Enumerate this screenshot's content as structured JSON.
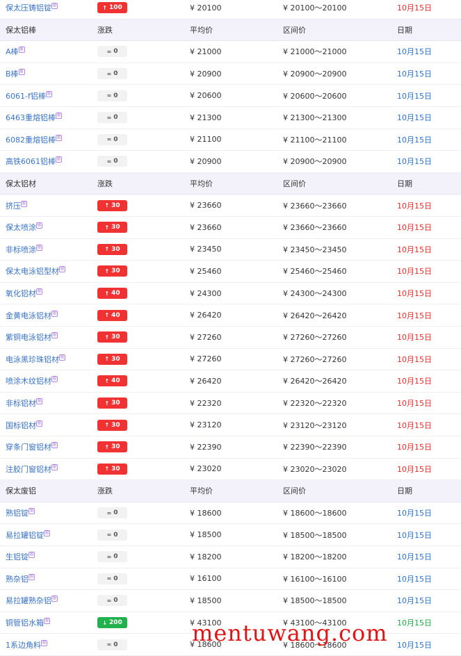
{
  "top_row": {
    "name": "保太压铸铝锭",
    "change": "100",
    "dir": "up",
    "avg": "¥  20100",
    "range": "¥  20100～20100",
    "date": "10月15日",
    "date_color": "red"
  },
  "sections": [
    {
      "header": {
        "name": "保太铝棒",
        "change": "涨跌",
        "avg": "平均价",
        "range": "区间价",
        "date": "日期"
      },
      "rows": [
        {
          "name": "A棒",
          "change": "0",
          "dir": "flat",
          "avg": "¥  21000",
          "range": "¥  21000～21000",
          "date": "10月15日",
          "date_color": "blue"
        },
        {
          "name": "B棒",
          "change": "0",
          "dir": "flat",
          "avg": "¥  20900",
          "range": "¥  20900～20900",
          "date": "10月15日",
          "date_color": "blue"
        },
        {
          "name": "6061-f铝棒",
          "change": "0",
          "dir": "flat",
          "avg": "¥  20600",
          "range": "¥  20600～20600",
          "date": "10月15日",
          "date_color": "blue"
        },
        {
          "name": "6463重熔铝棒",
          "change": "0",
          "dir": "flat",
          "avg": "¥  21300",
          "range": "¥  21300～21300",
          "date": "10月15日",
          "date_color": "blue"
        },
        {
          "name": "6082重熔铝棒",
          "change": "0",
          "dir": "flat",
          "avg": "¥  21100",
          "range": "¥  21100～21100",
          "date": "10月15日",
          "date_color": "blue"
        },
        {
          "name": "高铁6061铝棒",
          "change": "0",
          "dir": "flat",
          "avg": "¥  20900",
          "range": "¥  20900～20900",
          "date": "10月15日",
          "date_color": "blue"
        }
      ]
    },
    {
      "header": {
        "name": "保太铝材",
        "change": "涨跌",
        "avg": "平均价",
        "range": "区间价",
        "date": "日期"
      },
      "rows": [
        {
          "name": "挤压",
          "change": "30",
          "dir": "up",
          "avg": "¥  23660",
          "range": "¥  23660～23660",
          "date": "10月15日",
          "date_color": "red"
        },
        {
          "name": "保太喷涂",
          "change": "30",
          "dir": "up",
          "avg": "¥  23660",
          "range": "¥  23660～23660",
          "date": "10月15日",
          "date_color": "red"
        },
        {
          "name": "非标喷涂",
          "change": "30",
          "dir": "up",
          "avg": "¥  23450",
          "range": "¥  23450～23450",
          "date": "10月15日",
          "date_color": "red"
        },
        {
          "name": "保太电泳铝型材",
          "change": "30",
          "dir": "up",
          "avg": "¥  25460",
          "range": "¥  25460～25460",
          "date": "10月15日",
          "date_color": "red"
        },
        {
          "name": "氧化铝材",
          "change": "40",
          "dir": "up",
          "avg": "¥  24300",
          "range": "¥  24300～24300",
          "date": "10月15日",
          "date_color": "red"
        },
        {
          "name": "金黄电泳铝材",
          "change": "40",
          "dir": "up",
          "avg": "¥  26420",
          "range": "¥  26420～26420",
          "date": "10月15日",
          "date_color": "red"
        },
        {
          "name": "紫铜电泳铝材",
          "change": "30",
          "dir": "up",
          "avg": "¥  27260",
          "range": "¥  27260～27260",
          "date": "10月15日",
          "date_color": "red"
        },
        {
          "name": "电泳黑珍珠铝材",
          "change": "30",
          "dir": "up",
          "avg": "¥  27260",
          "range": "¥  27260～27260",
          "date": "10月15日",
          "date_color": "red"
        },
        {
          "name": "喷涂木纹铝材",
          "change": "40",
          "dir": "up",
          "avg": "¥  26420",
          "range": "¥  26420～26420",
          "date": "10月15日",
          "date_color": "red"
        },
        {
          "name": "非标铝材",
          "change": "30",
          "dir": "up",
          "avg": "¥  22320",
          "range": "¥  22320～22320",
          "date": "10月15日",
          "date_color": "red"
        },
        {
          "name": "国标铝材",
          "change": "30",
          "dir": "up",
          "avg": "¥  23120",
          "range": "¥  23120～23120",
          "date": "10月15日",
          "date_color": "red"
        },
        {
          "name": "穿条门窗铝材",
          "change": "30",
          "dir": "up",
          "avg": "¥  22390",
          "range": "¥  22390～22390",
          "date": "10月15日",
          "date_color": "red"
        },
        {
          "name": "注胶门窗铝材",
          "change": "30",
          "dir": "up",
          "avg": "¥  23020",
          "range": "¥  23020～23020",
          "date": "10月15日",
          "date_color": "red"
        }
      ]
    },
    {
      "header": {
        "name": "保太废铝",
        "change": "涨跌",
        "avg": "平均价",
        "range": "区间价",
        "date": "日期"
      },
      "rows": [
        {
          "name": "熟铝锭",
          "change": "0",
          "dir": "flat",
          "avg": "¥  18600",
          "range": "¥  18600～18600",
          "date": "10月15日",
          "date_color": "blue"
        },
        {
          "name": "易拉罐铝锭",
          "change": "0",
          "dir": "flat",
          "avg": "¥  18500",
          "range": "¥  18500～18500",
          "date": "10月15日",
          "date_color": "blue"
        },
        {
          "name": "生铝锭",
          "change": "0",
          "dir": "flat",
          "avg": "¥  18200",
          "range": "¥  18200～18200",
          "date": "10月15日",
          "date_color": "blue"
        },
        {
          "name": "熟杂铝",
          "change": "0",
          "dir": "flat",
          "avg": "¥  16100",
          "range": "¥  16100～16100",
          "date": "10月15日",
          "date_color": "blue"
        },
        {
          "name": "易拉罐熟杂铝",
          "change": "0",
          "dir": "flat",
          "avg": "¥  18500",
          "range": "¥  18500～18500",
          "date": "10月15日",
          "date_color": "blue"
        },
        {
          "name": "铜管铝水箱",
          "change": "200",
          "dir": "down",
          "avg": "¥  43100",
          "range": "¥  43100～43100",
          "date": "10月15日",
          "date_color": "green"
        },
        {
          "name": "1系边角料",
          "change": "0",
          "dir": "flat",
          "avg": "¥  18600",
          "range": "¥  18600～18600",
          "date": "10月15日",
          "date_color": "blue"
        }
      ]
    }
  ],
  "tag_glyph": "图",
  "arrows": {
    "up": "↑",
    "down": "↓",
    "flat": "≈"
  },
  "colors": {
    "up": "#f03232",
    "down": "#22b14c",
    "flat": "#f2f2f2",
    "header_bg": "#f3f2fb",
    "name_link": "#3a73c4"
  },
  "watermark": "mentuwang.com"
}
